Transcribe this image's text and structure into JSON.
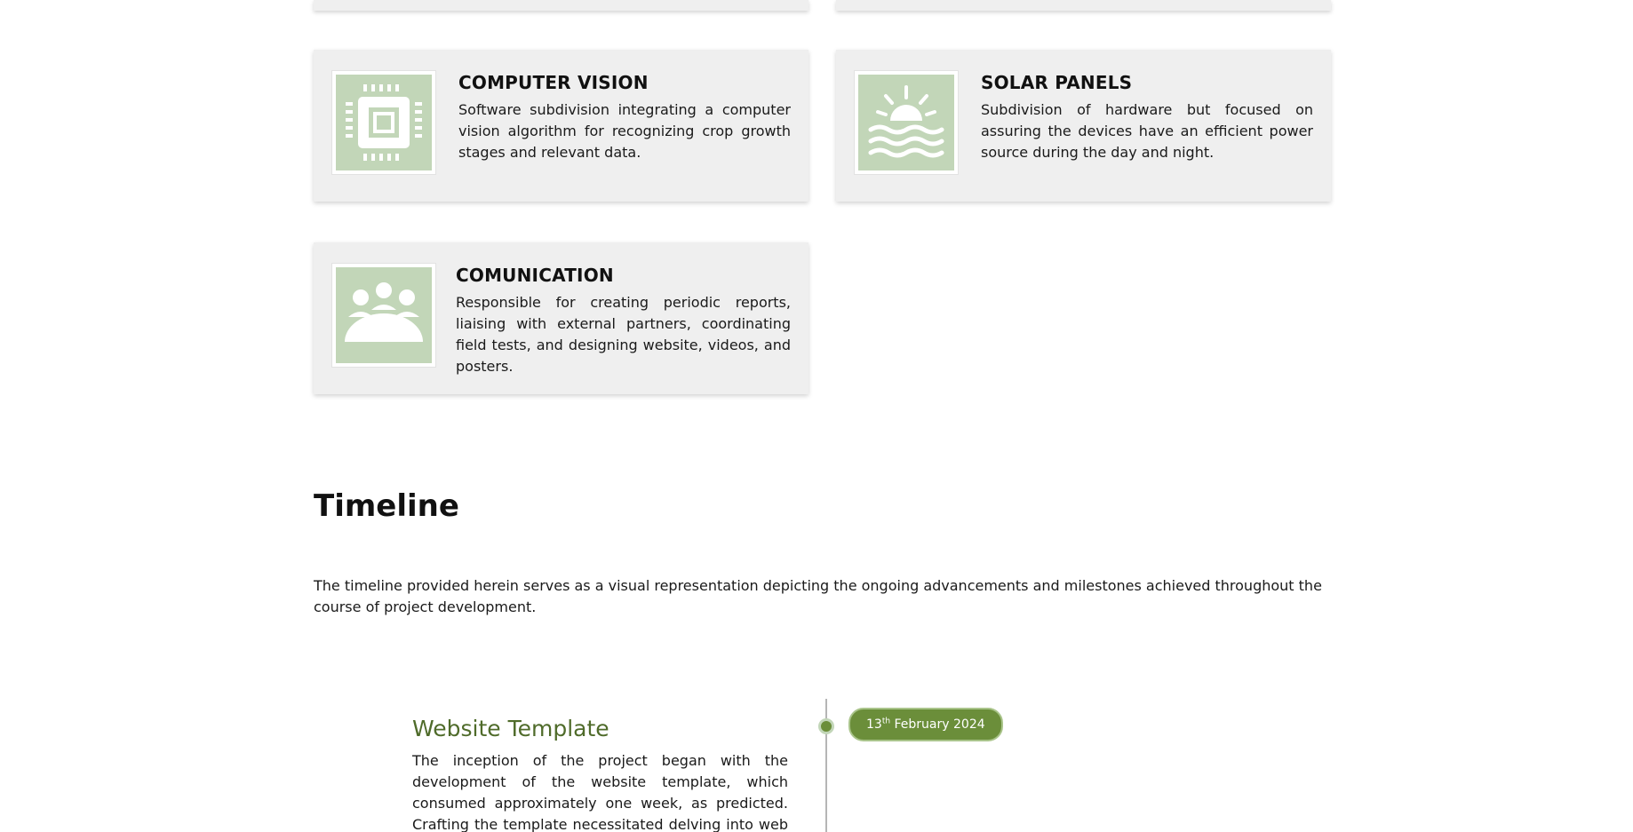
{
  "cards": [
    {
      "title": "COMPUTER VISION",
      "text": "Software subdivision integrating a computer vision algorithm for recognizing crop growth stages and relevant data.",
      "icon": "chip-icon"
    },
    {
      "title": "SOLAR PANELS",
      "text": "Subdivision of hardware but focused on assuring the devices have an efficient power source during the day and night.",
      "icon": "sunset-icon"
    },
    {
      "title": "COMUNICATION",
      "text": "Responsible for creating periodic reports, liaising with external partners, coordinating field tests, and designing website, videos, and posters.",
      "icon": "group-icon"
    }
  ],
  "timeline": {
    "title": "Timeline",
    "intro": "The timeline provided herein serves as a visual representation depicting the ongoing advancements and milestones achieved throughout the course of project development.",
    "entries": [
      {
        "date_day": "13",
        "date_suffix": "th",
        "date_rest": " February 2024",
        "title": "Website Template",
        "text": "The inception of the project began with the development of the website template, which consumed approximately one week, as predicted. Crafting the template necessitated delving into web development"
      }
    ]
  },
  "colors": {
    "card_bg": "#efefef",
    "icon_bg": "#c2d6b8",
    "accent": "#6b8e3a",
    "timeline_title": "#4f6b2a"
  }
}
